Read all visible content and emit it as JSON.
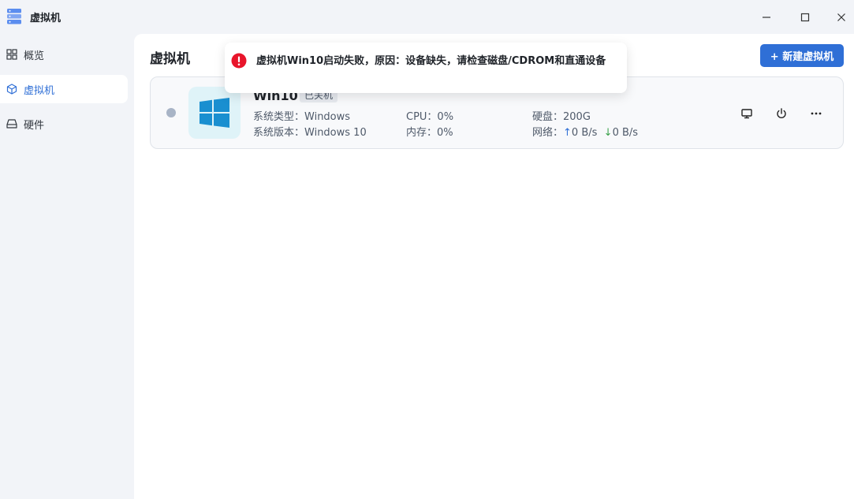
{
  "window": {
    "title": "虚拟机",
    "icon": "server-stack-icon"
  },
  "sidebar": {
    "items": [
      {
        "label": "概览",
        "icon": "grid-icon",
        "active": false
      },
      {
        "label": "虚拟机",
        "icon": "cube-icon",
        "active": true
      },
      {
        "label": "硬件",
        "icon": "drive-icon",
        "active": false
      }
    ]
  },
  "main": {
    "title": "虚拟机",
    "new_button": "+ 新建虚拟机"
  },
  "vm": {
    "name": "Win10",
    "status": "已关机",
    "os_type_label": "系统类型：",
    "os_type": "Windows",
    "os_version_label": "系统版本：",
    "os_version": "Windows 10",
    "cpu": "CPU：0%",
    "memory": "内存：0%",
    "disk": "硬盘：200G",
    "network_label": "网络：",
    "net_up": "0 B/s",
    "net_down": "0 B/s"
  },
  "toast": {
    "type": "error",
    "message": "虚拟机Win10启动失败，原因：设备缺失，请检查磁盘/CDROM和直通设备"
  },
  "colors": {
    "accent": "#2f6fd6",
    "error": "#e8152b",
    "status_off": "#a8b4c6"
  }
}
